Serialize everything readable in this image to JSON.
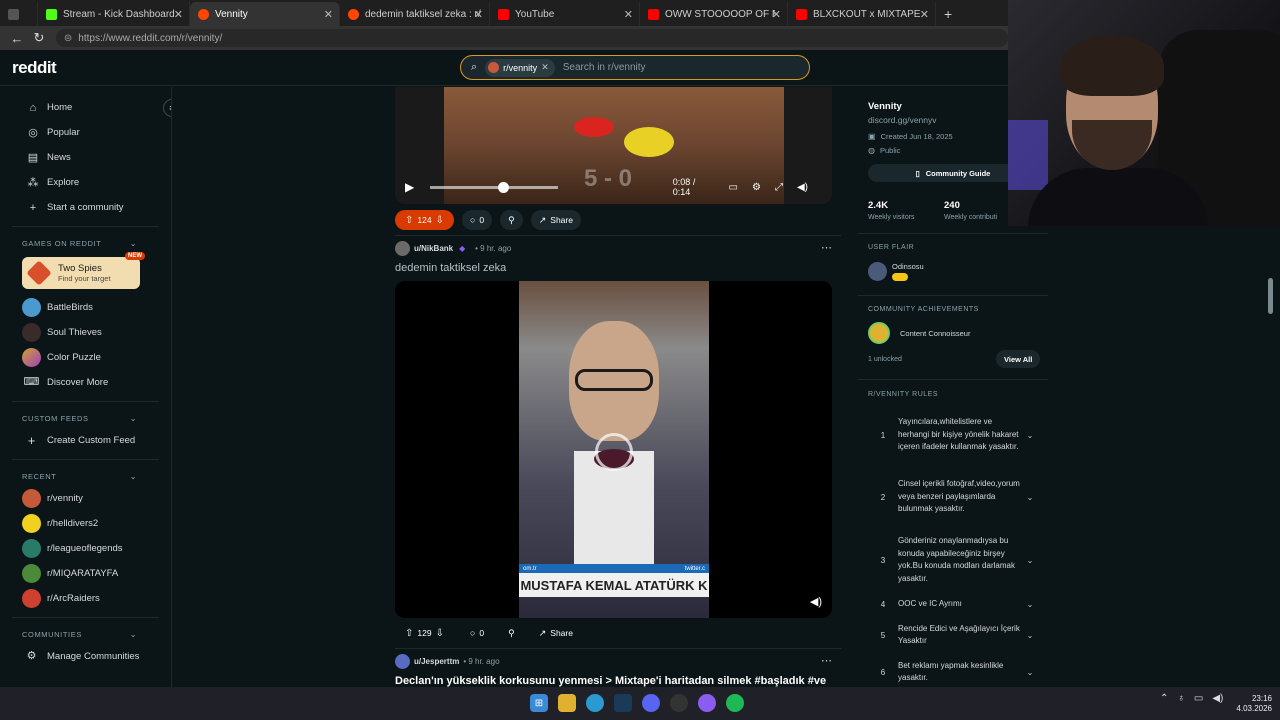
{
  "browser": {
    "tabs": [
      {
        "label": "",
        "color": "#555555"
      },
      {
        "label": "Stream - Kick Dashboard",
        "color": "#53fc18"
      },
      {
        "label": "Vennity",
        "color": "#ff4500"
      },
      {
        "label": "dedemin taktiksel zeka : r/vennity",
        "color": "#ff4500"
      },
      {
        "label": "YouTube",
        "color": "#ff0000"
      },
      {
        "label": "OWW STOOOOOP OF FUNNY MO",
        "color": "#ff0000"
      },
      {
        "label": "BLXCKOUT x MIXTAPE ÇATIŞMA |",
        "color": "#ff0000"
      }
    ],
    "new_tab": "+",
    "url": "https://www.reddit.com/r/vennity/"
  },
  "header": {
    "logo": "reddit",
    "search_chip": "r/vennity",
    "search_placeholder": "Search in r/vennity"
  },
  "left_nav": {
    "items": [
      {
        "label": "Home",
        "icon": "home-icon"
      },
      {
        "label": "Popular",
        "icon": "popular-icon"
      },
      {
        "label": "News",
        "icon": "news-icon"
      },
      {
        "label": "Explore",
        "icon": "explore-icon"
      },
      {
        "label": "Start a community",
        "icon": "plus-icon"
      }
    ],
    "games_heading": "GAMES ON REDDIT",
    "featured_game": {
      "title": "Two Spies",
      "subtitle": "Find your target",
      "badge": "NEW"
    },
    "games": [
      {
        "label": "BattleBirds",
        "color": "#4a9ad0"
      },
      {
        "label": "Soul Thieves",
        "color": "#3a2a2a"
      },
      {
        "label": "Color Puzzle",
        "color": "#d0a030"
      },
      {
        "label": "Discover More",
        "color": ""
      }
    ],
    "custom_heading": "CUSTOM FEEDS",
    "create_feed": "Create Custom Feed",
    "recent_heading": "RECENT",
    "recent": [
      {
        "label": "r/vennity",
        "color": "#c55a3a"
      },
      {
        "label": "r/helldivers2",
        "color": "#f0d020"
      },
      {
        "label": "r/leagueoflegends",
        "color": "#2a7a6a"
      },
      {
        "label": "r/MIQARATAYFA",
        "color": "#4a8a3a"
      },
      {
        "label": "r/ArcRaiders",
        "color": "#d04030"
      }
    ],
    "communities_heading": "COMMUNITIES",
    "manage": "Manage Communities"
  },
  "feed": {
    "post1": {
      "time": "0:08 / 0:14",
      "score_overlay": "5 - 0",
      "progress": 0.57,
      "votes": "124",
      "comments": "0",
      "share": "Share"
    },
    "post2": {
      "user": "u/NikBank",
      "age": "• 9 hr. ago",
      "title": "dedemin taktiksel zeka",
      "caption": "MUSTAFA KEMAL ATATÜRK K",
      "ticker_left": "om.tr",
      "ticker_right": "twitter.c",
      "votes": "129",
      "comments": "0",
      "share": "Share"
    },
    "post3": {
      "user": "u/Jesperttm",
      "age": "• 9 hr. ago",
      "title": "Declan'ın yükseklik korkusunu yenmesi > Mixtape'i haritadan silmek #başladık #ve"
    }
  },
  "right_sidebar": {
    "name": "Vennity",
    "link": "discord.gg/vennyv",
    "created": "Created Jun 18, 2025",
    "visibility": "Public",
    "guide_button": "Community Guide",
    "visitors": "2.4K",
    "visitors_label": "Weekly visitors",
    "contributions": "240",
    "contributions_label": "Weekly contributi",
    "flair_heading": "USER FLAIR",
    "flair_user": "Odinsosu",
    "achievements_heading": "COMMUNITY ACHIEVEMENTS",
    "achievement": "Content Connoisseur",
    "unlocked": "1 unlocked",
    "view_all": "View All",
    "rules_heading": "R/VENNITY RULES",
    "rules": [
      {
        "n": "1",
        "text": "Yayıncılara,whitelistlere ve herhangi bir kişiye yönelik hakaret içeren ifadeler kullanmak yasaktır."
      },
      {
        "n": "2",
        "text": "Cinsel içerikli fotoğraf,video,yorum veya benzeri paylaşımlarda bulunmak yasaktır."
      },
      {
        "n": "3",
        "text": "Gönderiniz onaylanmadıysa bu konuda yapabileceğiniz birşey yok.Bu konuda modları darlamak yasaktır."
      },
      {
        "n": "4",
        "text": "OOC ve IC Ayrımı"
      },
      {
        "n": "5",
        "text": "Rencide Edici ve Aşağılayıcı İçerik Yasaktır"
      },
      {
        "n": "6",
        "text": "Bet reklamı yapmak kesinlikle yasaktır."
      }
    ]
  },
  "taskbar": {
    "time": "23:16",
    "date": "4.03.2026"
  }
}
